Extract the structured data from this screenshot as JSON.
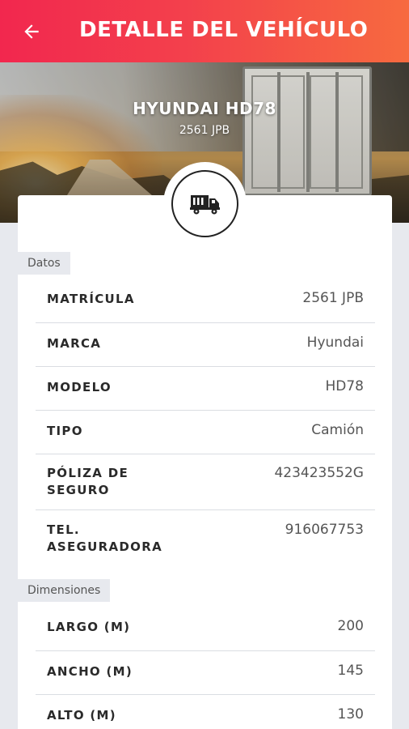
{
  "header": {
    "title": "DETALLE DEL VEHÍCULO",
    "back_icon": "arrow-left-icon"
  },
  "vehicle": {
    "name": "HYUNDAI HD78",
    "plate": "2561 JPB",
    "badge_icon": "truck-icon"
  },
  "sections": [
    {
      "label": "Datos",
      "rows": [
        {
          "key": "MATRÍCULA",
          "value": "2561 JPB"
        },
        {
          "key": "MARCA",
          "value": "Hyundai"
        },
        {
          "key": "MODELO",
          "value": "HD78"
        },
        {
          "key": "TIPO",
          "value": "Camión"
        },
        {
          "key": "PÓLIZA DE\nSEGURO",
          "value": "423423552G"
        },
        {
          "key": "TEL.\nASEGURADORA",
          "value": "916067753"
        }
      ]
    },
    {
      "label": "Dimensiones",
      "rows": [
        {
          "key": "LARGO (M)",
          "value": "200"
        },
        {
          "key": "ANCHO (M)",
          "value": "145"
        },
        {
          "key": "ALTO (M)",
          "value": "130"
        }
      ]
    }
  ],
  "colors": {
    "header_start": "#f2274e",
    "header_end": "#f76a3f"
  }
}
